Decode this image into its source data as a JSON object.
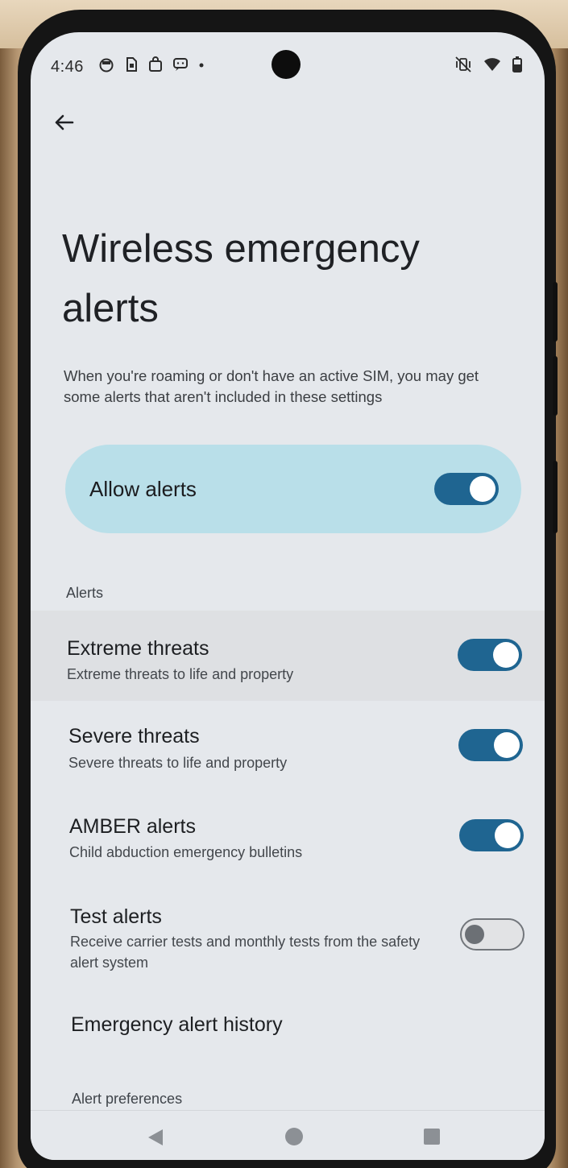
{
  "status_bar": {
    "time": "4:46",
    "notification_icons": [
      "timer-icon",
      "sim-icon",
      "bag-icon",
      "message-icon",
      "dot-icon"
    ],
    "right_icons": [
      "vibrate-off-icon",
      "wifi-icon",
      "battery-icon"
    ]
  },
  "header": {
    "back_icon": "arrow-left-icon",
    "title": "Wireless emergency alerts",
    "description": "When you're roaming or don't have an active SIM, you may get some alerts that aren't included in these settings"
  },
  "allow_alerts": {
    "label": "Allow alerts",
    "enabled": true
  },
  "alerts_section": {
    "header": "Alerts",
    "items": [
      {
        "title": "Extreme threats",
        "subtitle": "Extreme threats to life and property",
        "enabled": true
      },
      {
        "title": "Severe threats",
        "subtitle": "Severe threats to life and property",
        "enabled": true
      },
      {
        "title": "AMBER alerts",
        "subtitle": "Child abduction emergency bulletins",
        "enabled": true
      },
      {
        "title": "Test alerts",
        "subtitle": "Receive carrier tests and monthly tests from the safety alert system",
        "enabled": false
      }
    ],
    "history": "Emergency alert history"
  },
  "preferences_section": {
    "header": "Alert preferences"
  },
  "navigation": {
    "icons": [
      "nav-back-icon",
      "nav-home-icon",
      "nav-recents-icon"
    ]
  },
  "colors": {
    "toggle_on": "#1f6591",
    "allow_card": "#b9dfe9",
    "screen_bg": "#e5e8ec"
  }
}
